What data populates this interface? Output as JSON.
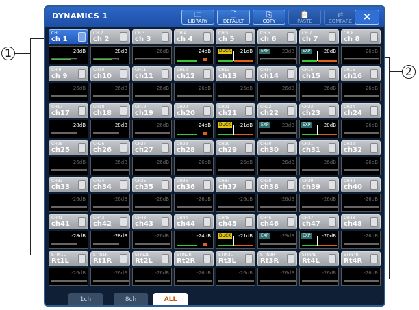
{
  "callouts": {
    "left": "1",
    "right": "2"
  },
  "window": {
    "title": "DYNAMICS 1"
  },
  "toolbar": [
    {
      "label": "LIBRARY",
      "icon": "folder-icon",
      "glyph": "🗀",
      "enabled": true
    },
    {
      "label": "DEFAULT",
      "icon": "document-icon",
      "glyph": "🗋",
      "enabled": true
    },
    {
      "label": "COPY",
      "icon": "copy-icon",
      "glyph": "⎘",
      "enabled": true
    },
    {
      "label": "PASTE",
      "icon": "paste-icon",
      "glyph": "📋",
      "enabled": false
    },
    {
      "label": "COMPARE",
      "icon": "compare-icon",
      "glyph": "⇄",
      "enabled": false
    }
  ],
  "close_label": "×",
  "tabs": [
    {
      "label": "1ch",
      "active": false
    },
    {
      "label": "8ch",
      "active": false
    },
    {
      "label": "ALL",
      "active": true
    }
  ],
  "colors": {
    "accent": "#2b66c6",
    "meter_green": "#35c835",
    "meter_orange": "#e0601a",
    "duck": "#e0c318",
    "exp": "#2d6f6f"
  },
  "channels": [
    {
      "num": "CH 1",
      "name": "ch 1",
      "value": "-28dB",
      "type": "comp",
      "selected": true
    },
    {
      "num": "CH 2",
      "name": "ch 2",
      "value": "-28dB",
      "type": "comp"
    },
    {
      "num": "CH 3",
      "name": "ch 3",
      "value": "-26dB",
      "type": "none"
    },
    {
      "num": "CH 4",
      "name": "ch 4",
      "value": "-24dB",
      "type": "gate"
    },
    {
      "num": "CH 5",
      "name": "ch 5",
      "value": "-21dB",
      "type": "duck",
      "label": "DUCK"
    },
    {
      "num": "CH 6",
      "name": "ch 6",
      "value": "-23dB",
      "type": "exp-off",
      "label": "EXP"
    },
    {
      "num": "CH 7",
      "name": "ch 7",
      "value": "-20dB",
      "type": "exp",
      "label": "EXP"
    },
    {
      "num": "CH 8",
      "name": "ch 8",
      "value": "-26dB",
      "type": "none"
    },
    {
      "num": "CH 9",
      "name": "ch 9",
      "value": "-26dB",
      "type": "none"
    },
    {
      "num": "CH10",
      "name": "ch10",
      "value": "-26dB",
      "type": "none"
    },
    {
      "num": "CH11",
      "name": "ch11",
      "value": "-26dB",
      "type": "none"
    },
    {
      "num": "CH12",
      "name": "ch12",
      "value": "-26dB",
      "type": "none"
    },
    {
      "num": "CH13",
      "name": "ch13",
      "value": "-26dB",
      "type": "none"
    },
    {
      "num": "CH14",
      "name": "ch14",
      "value": "-26dB",
      "type": "none"
    },
    {
      "num": "CH15",
      "name": "ch15",
      "value": "-26dB",
      "type": "none"
    },
    {
      "num": "CH16",
      "name": "ch16",
      "value": "-26dB",
      "type": "none"
    },
    {
      "num": "CH17",
      "name": "ch17",
      "value": "-28dB",
      "type": "comp"
    },
    {
      "num": "CH18",
      "name": "ch18",
      "value": "-28dB",
      "type": "comp"
    },
    {
      "num": "CH19",
      "name": "ch19",
      "value": "-26dB",
      "type": "none"
    },
    {
      "num": "CH20",
      "name": "ch20",
      "value": "-24dB",
      "type": "gate"
    },
    {
      "num": "CH21",
      "name": "ch21",
      "value": "-21dB",
      "type": "duck",
      "label": "DUCK"
    },
    {
      "num": "CH22",
      "name": "ch22",
      "value": "-23dB",
      "type": "exp-off",
      "label": "EXP"
    },
    {
      "num": "CH23",
      "name": "ch23",
      "value": "-20dB",
      "type": "exp",
      "label": "EXP"
    },
    {
      "num": "CH24",
      "name": "ch24",
      "value": "-26dB",
      "type": "none"
    },
    {
      "num": "CH25",
      "name": "ch25",
      "value": "-26dB",
      "type": "none"
    },
    {
      "num": "CH26",
      "name": "ch26",
      "value": "-26dB",
      "type": "none"
    },
    {
      "num": "CH27",
      "name": "ch27",
      "value": "-26dB",
      "type": "none"
    },
    {
      "num": "CH28",
      "name": "ch28",
      "value": "-26dB",
      "type": "none"
    },
    {
      "num": "CH29",
      "name": "ch29",
      "value": "-26dB",
      "type": "none"
    },
    {
      "num": "CH30",
      "name": "ch30",
      "value": "-26dB",
      "type": "none"
    },
    {
      "num": "CH31",
      "name": "ch31",
      "value": "-26dB",
      "type": "none"
    },
    {
      "num": "CH32",
      "name": "ch32",
      "value": "-26dB",
      "type": "none"
    },
    {
      "num": "CH33",
      "name": "ch33",
      "value": "-26dB",
      "type": "none"
    },
    {
      "num": "CH34",
      "name": "ch34",
      "value": "-26dB",
      "type": "none"
    },
    {
      "num": "CH35",
      "name": "ch35",
      "value": "-26dB",
      "type": "none"
    },
    {
      "num": "CH36",
      "name": "ch36",
      "value": "-26dB",
      "type": "none"
    },
    {
      "num": "CH37",
      "name": "ch37",
      "value": "-26dB",
      "type": "none"
    },
    {
      "num": "CH38",
      "name": "ch38",
      "value": "-26dB",
      "type": "none"
    },
    {
      "num": "CH39",
      "name": "ch39",
      "value": "-26dB",
      "type": "none"
    },
    {
      "num": "CH40",
      "name": "ch40",
      "value": "-26dB",
      "type": "none"
    },
    {
      "num": "CH41",
      "name": "ch41",
      "value": "-28dB",
      "type": "comp"
    },
    {
      "num": "CH42",
      "name": "ch42",
      "value": "-28dB",
      "type": "comp"
    },
    {
      "num": "CH43",
      "name": "ch43",
      "value": "-26dB",
      "type": "none"
    },
    {
      "num": "CH44",
      "name": "ch44",
      "value": "-24dB",
      "type": "gate"
    },
    {
      "num": "CH45",
      "name": "ch45",
      "value": "-21dB",
      "type": "duck",
      "label": "DUCK"
    },
    {
      "num": "CH46",
      "name": "ch46",
      "value": "-23dB",
      "type": "exp-off",
      "label": "EXP"
    },
    {
      "num": "CH47",
      "name": "ch47",
      "value": "-20dB",
      "type": "exp",
      "label": "EXP"
    },
    {
      "num": "CH48",
      "name": "ch48",
      "value": "-26dB",
      "type": "none"
    },
    {
      "num": "STIN1L",
      "name": "Rt1L",
      "value": "-26dB",
      "type": "none"
    },
    {
      "num": "STIN1R",
      "name": "Rt1R",
      "value": "-26dB",
      "type": "none"
    },
    {
      "num": "STIN2L",
      "name": "Rt2L",
      "value": "-26dB",
      "type": "none"
    },
    {
      "num": "STIN2R",
      "name": "Rt2R",
      "value": "-26dB",
      "type": "none"
    },
    {
      "num": "STIN3L",
      "name": "Rt3L",
      "value": "-26dB",
      "type": "none"
    },
    {
      "num": "STIN3R",
      "name": "Rt3R",
      "value": "-26dB",
      "type": "none"
    },
    {
      "num": "STIN4L",
      "name": "Rt4L",
      "value": "-26dB",
      "type": "none"
    },
    {
      "num": "STIN4R",
      "name": "Rt4R",
      "value": "-26dB",
      "type": "none"
    }
  ]
}
